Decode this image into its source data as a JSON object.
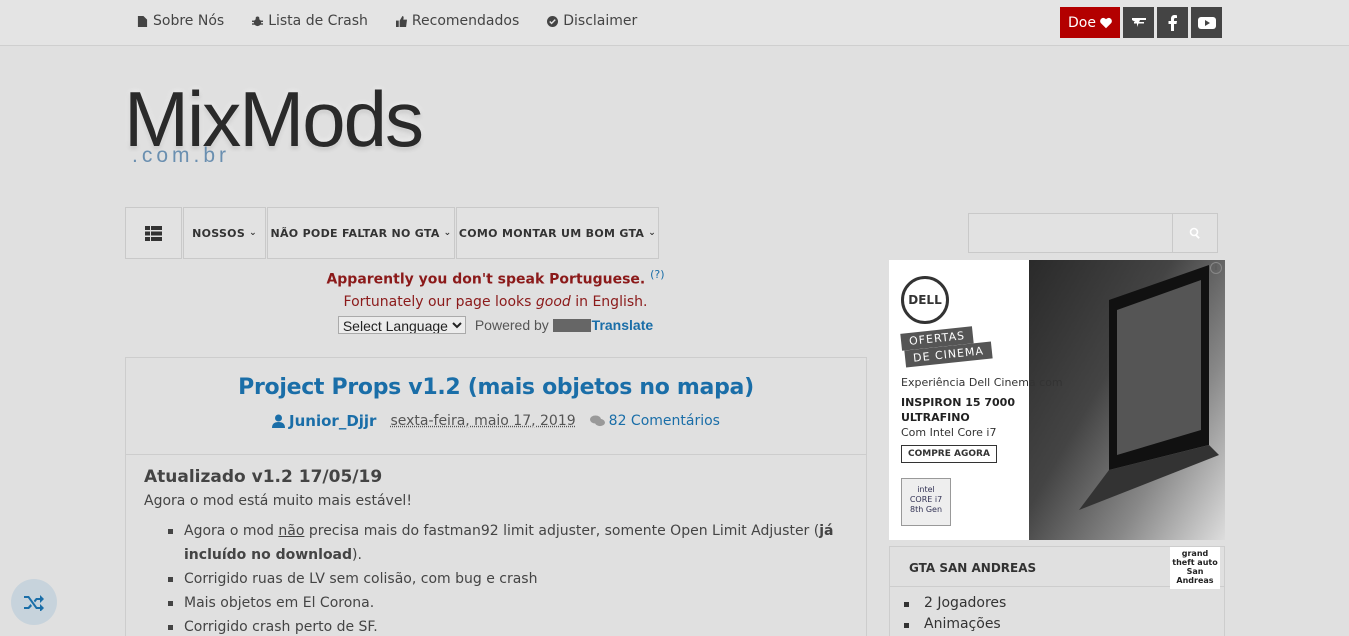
{
  "topnav": {
    "items": [
      {
        "label": "Sobre Nós",
        "icon": "file-icon"
      },
      {
        "label": "Lista de Crash",
        "icon": "bug-icon"
      },
      {
        "label": "Recomendados",
        "icon": "thumbs-up-icon"
      },
      {
        "label": "Disclaimer",
        "icon": "check-circle-icon"
      }
    ]
  },
  "social": {
    "donate_label": "Doe",
    "colors": {
      "donate": "#b30000",
      "icon_bg": "#444444"
    }
  },
  "logo": {
    "main": "MixMods",
    "sub": ".com.br"
  },
  "mainnav": {
    "items": [
      {
        "label": "NOSSOS"
      },
      {
        "label": "NÃO PODE FALTAR NO GTA"
      },
      {
        "label": "COMO MONTAR UM BOM GTA"
      }
    ]
  },
  "lang_notice": {
    "line1": "Apparently you don't speak Portuguese.",
    "help": "(?)",
    "line2_a": "Fortunately our page looks ",
    "line2_em": "good",
    "line2_b": " in English.",
    "select_value": "Select Language",
    "powered": "Powered by",
    "translate": "Translate"
  },
  "post": {
    "title": "Project Props v1.2 (mais objetos no mapa)",
    "author": "Junior_Djjr",
    "date": "sexta-feira, maio 17, 2019",
    "comments": "82 Comentários",
    "updated": "Atualizado v1.2 17/05/19",
    "intro": "Agora o mod está muito mais estável!",
    "bullet1_a": "Agora o mod ",
    "bullet1_u": "não",
    "bullet1_b": " precisa mais do fastman92 limit adjuster, somente Open Limit Adjuster (",
    "bullet1_bold": "já incluído no download",
    "bullet1_c": ").",
    "bullets": [
      "Corrigido ruas de LV sem colisão, com bug e crash",
      "Mais objetos em El Corona.",
      "Corrigido crash perto de SF."
    ]
  },
  "ad": {
    "brand": "DELL",
    "ofertas": "OFERTAS",
    "cinema": "DE CINEMA",
    "exp": "Experiência Dell Cinema com",
    "model1": "INSPIRON 15 7000",
    "model2": "ULTRAFINO",
    "intel": "Com Intel Core i7",
    "cta": "COMPRE AGORA",
    "chip1": "intel",
    "chip2": "CORE i7",
    "chip3": "8th Gen",
    "info": "i"
  },
  "widget": {
    "title": "GTA SAN ANDREAS",
    "logo_text": "grand theft auto San Andreas",
    "items": [
      "2 Jogadores",
      "Animações"
    ]
  }
}
